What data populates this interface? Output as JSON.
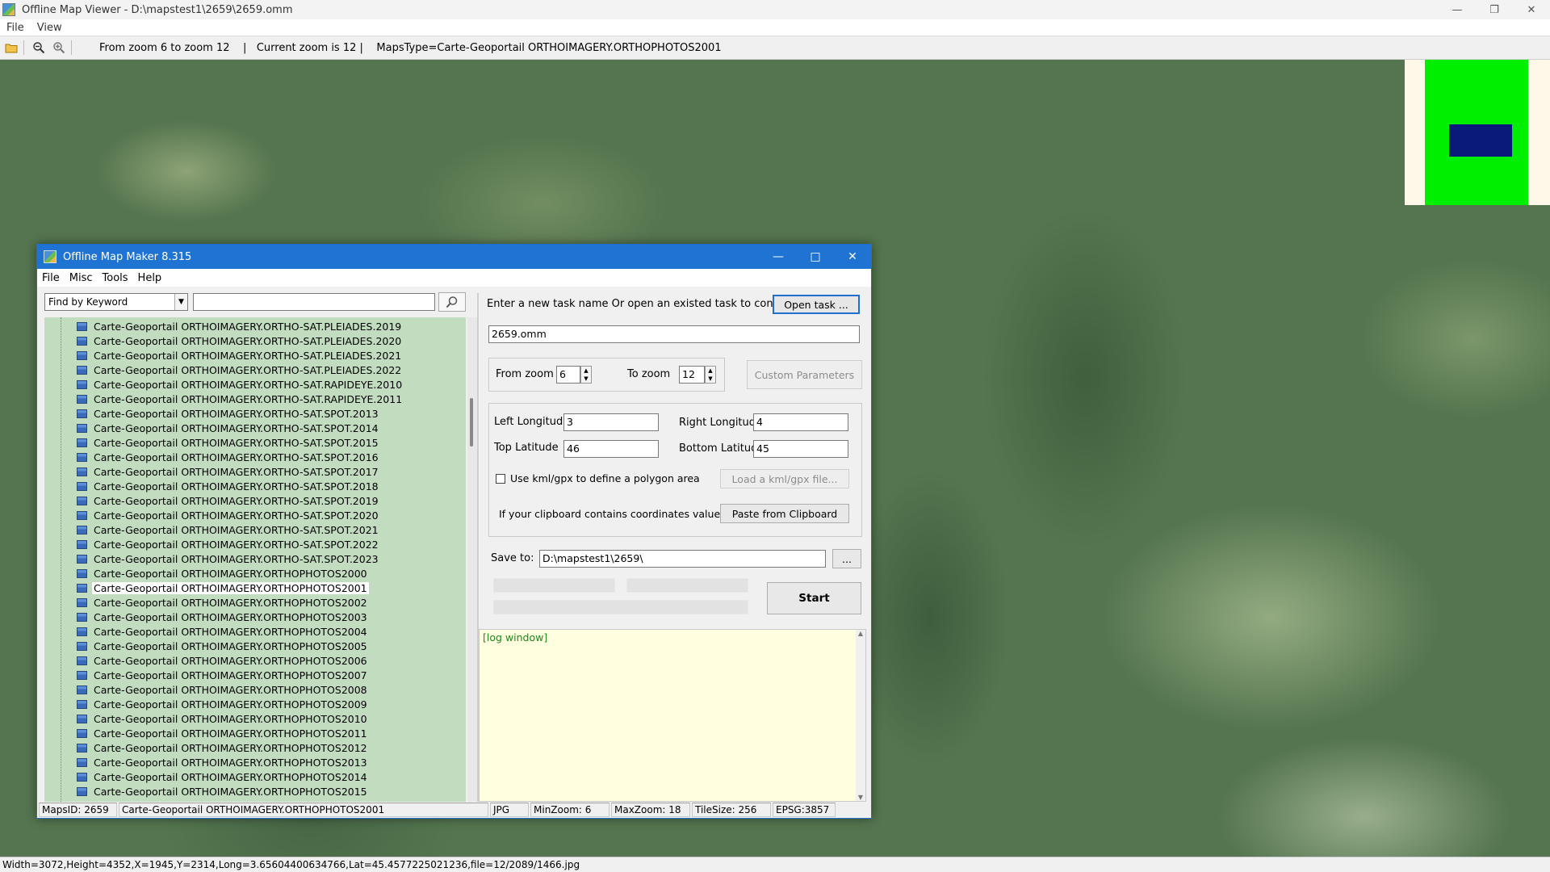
{
  "viewer": {
    "title": "Offline Map Viewer - D:\\mapstest1\\2659\\2659.omm",
    "menu": [
      "File",
      "View"
    ],
    "toolbar_info": "From zoom 6 to zoom 12    |   Current zoom is 12 |    MapsType=Carte-Geoportail ORTHOIMAGERY.ORTHOPHOTOS2001",
    "status": "Width=3072,Height=4352,X=1945,Y=2314,Long=3.65604400634766,Lat=45.4577225021236,file=12/2089/1466.jpg",
    "colors": {
      "minimap_extent": "#00ee00",
      "minimap_viewport": "#0a1a7a"
    }
  },
  "dialog": {
    "title": "Offline Map Maker 8.315",
    "menu": [
      "File",
      "Misc",
      "Tools",
      "Help"
    ],
    "search": {
      "mode": "Find by Keyword",
      "value": ""
    },
    "tree_items": [
      "Carte-Geoportail ORTHOIMAGERY.ORTHO-SAT.PLEIADES.2019",
      "Carte-Geoportail ORTHOIMAGERY.ORTHO-SAT.PLEIADES.2020",
      "Carte-Geoportail ORTHOIMAGERY.ORTHO-SAT.PLEIADES.2021",
      "Carte-Geoportail ORTHOIMAGERY.ORTHO-SAT.PLEIADES.2022",
      "Carte-Geoportail ORTHOIMAGERY.ORTHO-SAT.RAPIDEYE.2010",
      "Carte-Geoportail ORTHOIMAGERY.ORTHO-SAT.RAPIDEYE.2011",
      "Carte-Geoportail ORTHOIMAGERY.ORTHO-SAT.SPOT.2013",
      "Carte-Geoportail ORTHOIMAGERY.ORTHO-SAT.SPOT.2014",
      "Carte-Geoportail ORTHOIMAGERY.ORTHO-SAT.SPOT.2015",
      "Carte-Geoportail ORTHOIMAGERY.ORTHO-SAT.SPOT.2016",
      "Carte-Geoportail ORTHOIMAGERY.ORTHO-SAT.SPOT.2017",
      "Carte-Geoportail ORTHOIMAGERY.ORTHO-SAT.SPOT.2018",
      "Carte-Geoportail ORTHOIMAGERY.ORTHO-SAT.SPOT.2019",
      "Carte-Geoportail ORTHOIMAGERY.ORTHO-SAT.SPOT.2020",
      "Carte-Geoportail ORTHOIMAGERY.ORTHO-SAT.SPOT.2021",
      "Carte-Geoportail ORTHOIMAGERY.ORTHO-SAT.SPOT.2022",
      "Carte-Geoportail ORTHOIMAGERY.ORTHO-SAT.SPOT.2023",
      "Carte-Geoportail ORTHOIMAGERY.ORTHOPHOTOS2000",
      "Carte-Geoportail ORTHOIMAGERY.ORTHOPHOTOS2001",
      "Carte-Geoportail ORTHOIMAGERY.ORTHOPHOTOS2002",
      "Carte-Geoportail ORTHOIMAGERY.ORTHOPHOTOS2003",
      "Carte-Geoportail ORTHOIMAGERY.ORTHOPHOTOS2004",
      "Carte-Geoportail ORTHOIMAGERY.ORTHOPHOTOS2005",
      "Carte-Geoportail ORTHOIMAGERY.ORTHOPHOTOS2006",
      "Carte-Geoportail ORTHOIMAGERY.ORTHOPHOTOS2007",
      "Carte-Geoportail ORTHOIMAGERY.ORTHOPHOTOS2008",
      "Carte-Geoportail ORTHOIMAGERY.ORTHOPHOTOS2009",
      "Carte-Geoportail ORTHOIMAGERY.ORTHOPHOTOS2010",
      "Carte-Geoportail ORTHOIMAGERY.ORTHOPHOTOS2011",
      "Carte-Geoportail ORTHOIMAGERY.ORTHOPHOTOS2012",
      "Carte-Geoportail ORTHOIMAGERY.ORTHOPHOTOS2013",
      "Carte-Geoportail ORTHOIMAGERY.ORTHOPHOTOS2014",
      "Carte-Geoportail ORTHOIMAGERY.ORTHOPHOTOS2015"
    ],
    "selected_item": "Carte-Geoportail ORTHOIMAGERY.ORTHOPHOTOS2001",
    "task": {
      "prompt": "Enter a new task name Or open an existed task to continue:",
      "open_button": "Open task ...",
      "name": "2659.omm"
    },
    "zoom": {
      "from_label": "From zoom",
      "from_value": "6",
      "to_label": "To zoom",
      "to_value": "12",
      "custom_button": "Custom Parameters"
    },
    "coords": {
      "left_label": "Left Longitude",
      "left_value": "3",
      "right_label": "Right Longitude",
      "right_value": "4",
      "top_label": "Top Latitude",
      "top_value": "46",
      "bottom_label": "Bottom Latitude",
      "bottom_value": "45",
      "kml_label": "Use kml/gpx to define a polygon area",
      "kml_button": "Load a kml/gpx file...",
      "clipboard_label": "If your clipboard contains coordinates values:",
      "clipboard_button": "Paste from Clipboard"
    },
    "save": {
      "label": "Save to:",
      "value": "D:\\mapstest1\\2659\\",
      "browse": "..."
    },
    "start_button": "Start",
    "log_text": "[log window]",
    "status": {
      "maps_id": "MapsID: 2659",
      "maps_name": "Carte-Geoportail ORTHOIMAGERY.ORTHOPHOTOS2001",
      "format": "JPG",
      "min_zoom": "MinZoom: 6",
      "max_zoom": "MaxZoom: 18",
      "tile_size": "TileSize: 256",
      "epsg": "EPSG:3857"
    }
  }
}
